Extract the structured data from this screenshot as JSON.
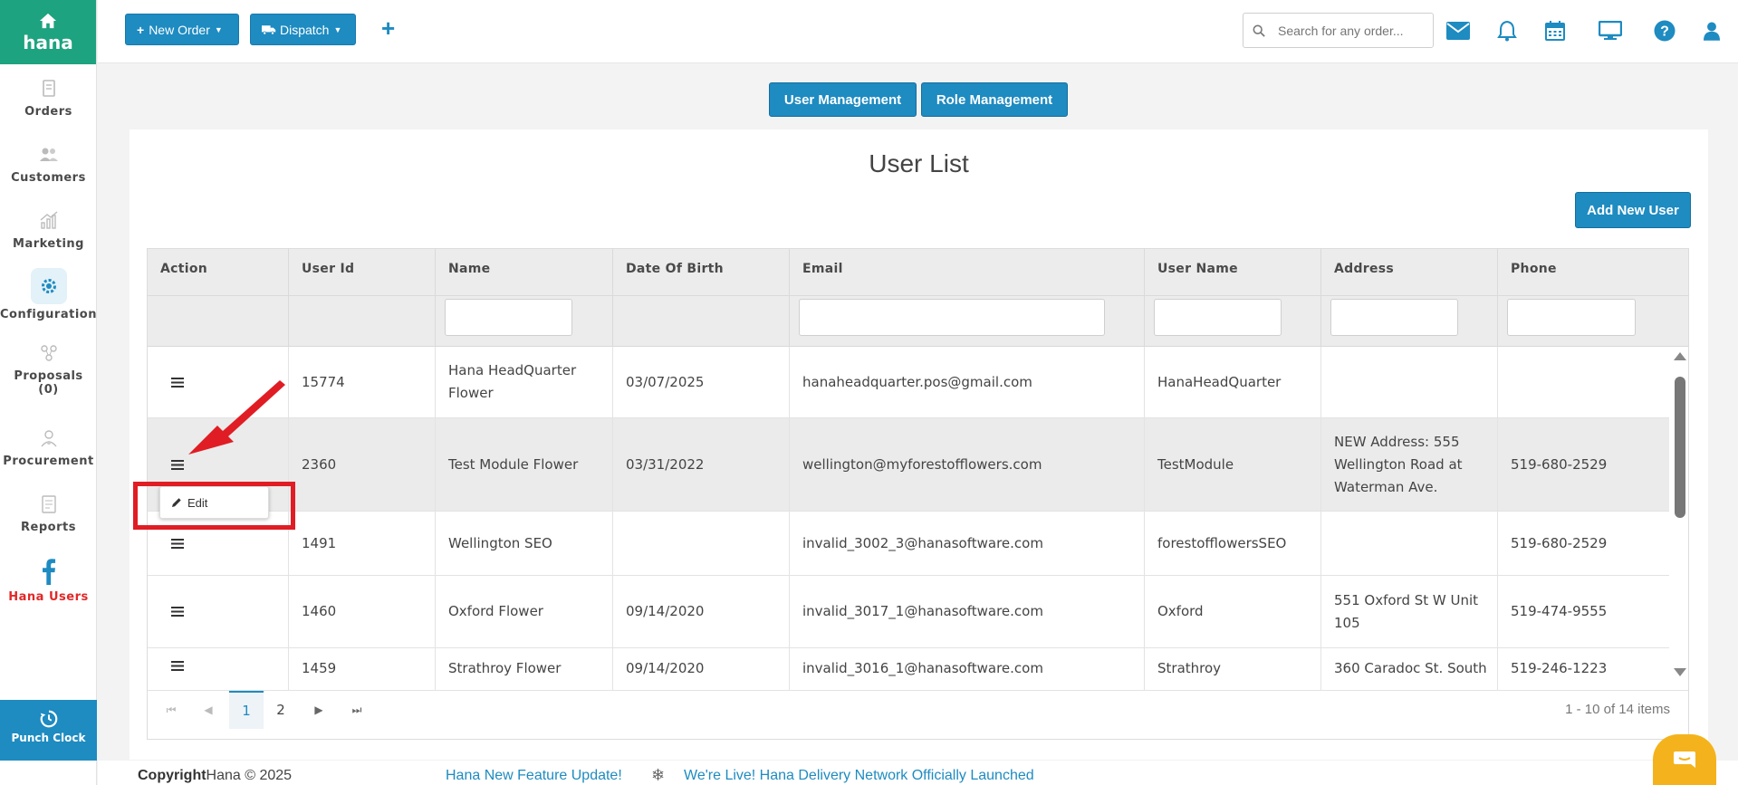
{
  "brand": "hana",
  "sidebar": {
    "items": [
      {
        "label": "Orders",
        "icon": "orders-icon"
      },
      {
        "label": "Customers",
        "icon": "customers-icon"
      },
      {
        "label": "Marketing",
        "icon": "marketing-icon"
      },
      {
        "label": "Configuration",
        "icon": "gear-icon"
      },
      {
        "label": "Proposals",
        "sub": "(0)",
        "icon": "proposals-icon"
      },
      {
        "label": "Procurement",
        "icon": "procurement-icon"
      },
      {
        "label": "Reports",
        "icon": "reports-icon"
      },
      {
        "label": "Hana Users",
        "icon": "facebook-icon"
      }
    ],
    "punch_label": "Punch Clock"
  },
  "topbar": {
    "new_order": "New Order",
    "dispatch": "Dispatch",
    "search_placeholder": "Search for any order..."
  },
  "tabs": {
    "user_mgmt": "User Management",
    "role_mgmt": "Role Management"
  },
  "page": {
    "title": "User List",
    "add_button": "Add New User"
  },
  "table": {
    "columns": [
      "Action",
      "User Id",
      "Name",
      "Date Of Birth",
      "Email",
      "User Name",
      "Address",
      "Phone"
    ],
    "rows": [
      {
        "id": "15774",
        "name": "Hana HeadQuarter Flower",
        "dob": "03/07/2025",
        "email": "hanaheadquarter.pos@gmail.com",
        "username": "HanaHeadQuarter",
        "address": "",
        "phone": ""
      },
      {
        "id": "2360",
        "name": "Test Module Flower",
        "dob": "03/31/2022",
        "email": "wellington@myforestofflowers.com",
        "username": "TestModule",
        "address": "NEW Address: 555 Wellington Road at Waterman Ave.",
        "phone": "519-680-2529"
      },
      {
        "id": "1491",
        "name": "Wellington SEO",
        "dob": "",
        "email": "invalid_3002_3@hanasoftware.com",
        "username": "forestofflowersSEO",
        "address": "",
        "phone": "519-680-2529"
      },
      {
        "id": "1460",
        "name": "Oxford Flower",
        "dob": "09/14/2020",
        "email": "invalid_3017_1@hanasoftware.com",
        "username": "Oxford",
        "address": "551 Oxford St W Unit 105",
        "phone": "519-474-9555"
      },
      {
        "id": "1459",
        "name": "Strathroy Flower",
        "dob": "09/14/2020",
        "email": "invalid_3016_1@hanasoftware.com",
        "username": "Strathroy",
        "address": "360 Caradoc St. South",
        "phone": "519-246-1223"
      }
    ]
  },
  "pager": {
    "pages": [
      "1",
      "2"
    ],
    "current": "1",
    "info": "1 - 10 of 14 items"
  },
  "popup": {
    "edit_label": "Edit"
  },
  "footer": {
    "copy_bold": "Copyright",
    "copy_rest": "Hana © 2025",
    "news1": "Hana New Feature Update!",
    "news2": "We're Live! Hana Delivery Network Officially Launched"
  },
  "colors": {
    "brand_green": "#1da37f",
    "primary_blue": "#1e8bc1",
    "highlight_red": "#e01d24",
    "chat_yellow": "#f4b31c"
  }
}
